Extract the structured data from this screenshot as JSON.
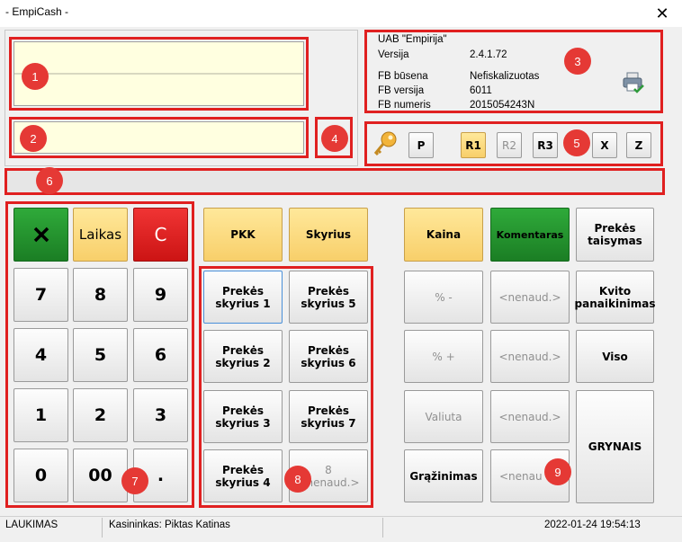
{
  "window": {
    "title": "- EmpiCash -"
  },
  "info": {
    "company": "UAB \"Empirija\"",
    "rows": [
      {
        "label": "Versija",
        "value": "2.4.1.72"
      },
      {
        "label": "FB būsena",
        "value": "Nefiskalizuotas"
      },
      {
        "label": "FB versija",
        "value": "6011"
      },
      {
        "label": "FB numeris",
        "value": "2015054243N"
      }
    ]
  },
  "fiscal_buttons": [
    "P",
    "R1",
    "R2",
    "R3",
    "X",
    "Z"
  ],
  "keypad": {
    "confirm_icon": "check-x-icon",
    "time": "Laikas",
    "clear": "C",
    "digits": [
      "7",
      "8",
      "9",
      "4",
      "5",
      "6",
      "1",
      "2",
      "3",
      "0",
      "00",
      "."
    ]
  },
  "departments": {
    "pkk": "PKK",
    "skyrius": "Skyrius",
    "items": [
      [
        "Prekės",
        "skyrius 1"
      ],
      [
        "Prekės",
        "skyrius 5"
      ],
      [
        "Prekės",
        "skyrius 2"
      ],
      [
        "Prekės",
        "skyrius 6"
      ],
      [
        "Prekės",
        "skyrius 3"
      ],
      [
        "Prekės",
        "skyrius 7"
      ],
      [
        "Prekės",
        "skyrius 4"
      ],
      [
        "8",
        "<nenaud.>"
      ]
    ]
  },
  "functions": {
    "kaina": "Kaina",
    "komentaras": "Komentaras",
    "prekes_taisymas": [
      "Prekės",
      "taisymas"
    ],
    "discount": "% -",
    "markup": "% +",
    "valiuta": "Valiuta",
    "grazinimas": "Grąžinimas",
    "unused": "<nenaud.>",
    "unused_last": "<nenau",
    "kvito": [
      "Kvito",
      "panaikinimas"
    ],
    "viso": "Viso",
    "grynais": "GRYNAIS"
  },
  "markers": [
    "1",
    "2",
    "3",
    "4",
    "5",
    "6",
    "7",
    "8",
    "9"
  ],
  "status": {
    "mode": "LAUKIMAS",
    "cashier": "Kasininkas: Piktas Katinas",
    "datetime": "2022-01-24 19:54:13"
  },
  "colors": {
    "highlight": "#e02020",
    "marker": "#e53935",
    "field": "#ffffe0",
    "yellow": "#f8cf6a",
    "green": "#1b7e24",
    "red": "#cc1414"
  }
}
